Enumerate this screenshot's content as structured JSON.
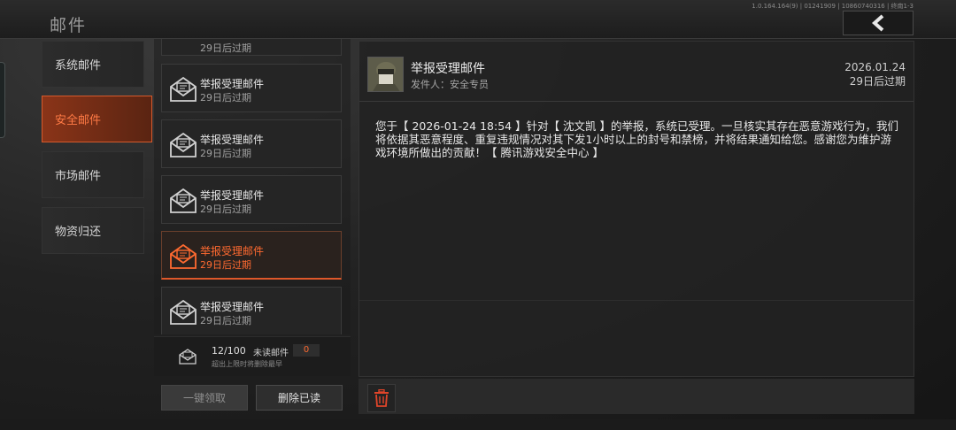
{
  "header": {
    "title": "邮件",
    "version": "1.0.164.164(9) | 01241909 | 10860740316 | 终南1-3"
  },
  "categories": [
    {
      "label": "系统邮件",
      "active": false
    },
    {
      "label": "安全邮件",
      "active": true
    },
    {
      "label": "市场邮件",
      "active": false
    },
    {
      "label": "物资归还",
      "active": false
    }
  ],
  "mail_list": {
    "partial_top_expire": "29日后过期",
    "items": [
      {
        "title": "举报受理邮件",
        "expire": "29日后过期",
        "active": false
      },
      {
        "title": "举报受理邮件",
        "expire": "29日后过期",
        "active": false
      },
      {
        "title": "举报受理邮件",
        "expire": "29日后过期",
        "active": false
      },
      {
        "title": "举报受理邮件",
        "expire": "29日后过期",
        "active": true
      },
      {
        "title": "举报受理邮件",
        "expire": "29日后过期",
        "active": false
      }
    ]
  },
  "counter": {
    "count": "12/100",
    "unread_label": "未读邮件",
    "unread_count": "0",
    "note": "超出上限时将删除最早"
  },
  "buttons": {
    "claim_all": "一键领取",
    "delete_read": "删除已读"
  },
  "detail": {
    "title": "举报受理邮件",
    "sender": "发件人：安全专员",
    "date": "2026.01.24",
    "expire": "29日后过期",
    "body": "您于【 2026-01-24 18:54 】针对【 沈文凯 】的举报，系统已受理。一旦核实其存在恶意游戏行为，我们将依据其恶意程度、重复违规情况对其下发1小时以上的封号和禁榜，并将结果通知给您。感谢您为维护游戏环境所做出的贡献！【 腾讯游戏安全中心 】"
  },
  "colors": {
    "accent": "#ff6a30",
    "active_tab_bg": "#8a3418",
    "trash_icon": "#e0452a"
  },
  "icons": {
    "back": "chevron-left-icon",
    "mail": "envelope-icon",
    "delete": "trash-icon"
  }
}
